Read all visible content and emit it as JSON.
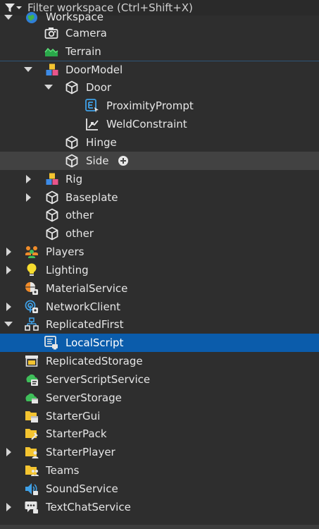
{
  "filter": {
    "placeholder": "Filter workspace (Ctrl+Shift+X)"
  },
  "colors": {
    "background": "#2e2e2e",
    "selected": "#0b5cab",
    "hover": "#424242",
    "text": "#e6e6e6"
  },
  "tree": {
    "workspace": {
      "label": "Workspace",
      "icon": "workspace-globe-icon",
      "expanded": true
    },
    "camera": {
      "label": "Camera",
      "icon": "camera-icon"
    },
    "terrain": {
      "label": "Terrain",
      "icon": "terrain-icon"
    },
    "doormodel": {
      "label": "DoorModel",
      "icon": "model-icon",
      "expanded": true
    },
    "door": {
      "label": "Door",
      "icon": "part-cube-icon",
      "expanded": true
    },
    "proximityprompt": {
      "label": "ProximityPrompt",
      "icon": "proximity-prompt-icon"
    },
    "weldconstraint": {
      "label": "WeldConstraint",
      "icon": "weld-constraint-icon"
    },
    "hinge": {
      "label": "Hinge",
      "icon": "part-cube-icon"
    },
    "side": {
      "label": "Side",
      "icon": "part-cube-icon",
      "state": "hovered"
    },
    "rig": {
      "label": "Rig",
      "icon": "model-icon",
      "expanded": false
    },
    "baseplate": {
      "label": "Baseplate",
      "icon": "part-cube-icon",
      "expanded": false
    },
    "other1": {
      "label": "other",
      "icon": "part-cube-icon"
    },
    "other2": {
      "label": "other",
      "icon": "part-cube-icon"
    },
    "players": {
      "label": "Players",
      "icon": "players-icon",
      "expanded": false
    },
    "lighting": {
      "label": "Lighting",
      "icon": "lightbulb-icon",
      "expanded": false
    },
    "materialservice": {
      "label": "MaterialService",
      "icon": "material-service-icon"
    },
    "networkclient": {
      "label": "NetworkClient",
      "icon": "network-client-icon",
      "expanded": false
    },
    "replicatedfirst": {
      "label": "ReplicatedFirst",
      "icon": "replicated-first-icon",
      "expanded": true
    },
    "localscript": {
      "label": "LocalScript",
      "icon": "local-script-icon",
      "state": "selected"
    },
    "replicatedstorage": {
      "label": "ReplicatedStorage",
      "icon": "replicated-storage-icon"
    },
    "serverscriptservice": {
      "label": "ServerScriptService",
      "icon": "server-script-service-icon"
    },
    "serverstorage": {
      "label": "ServerStorage",
      "icon": "server-storage-icon"
    },
    "startergui": {
      "label": "StarterGui",
      "icon": "starter-gui-icon"
    },
    "starterpack": {
      "label": "StarterPack",
      "icon": "starter-pack-icon"
    },
    "starterplayer": {
      "label": "StarterPlayer",
      "icon": "starter-player-icon",
      "expanded": false
    },
    "teams": {
      "label": "Teams",
      "icon": "teams-icon"
    },
    "soundservice": {
      "label": "SoundService",
      "icon": "sound-service-icon"
    },
    "textchatservice": {
      "label": "TextChatService",
      "icon": "text-chat-service-icon",
      "expanded": false
    }
  }
}
